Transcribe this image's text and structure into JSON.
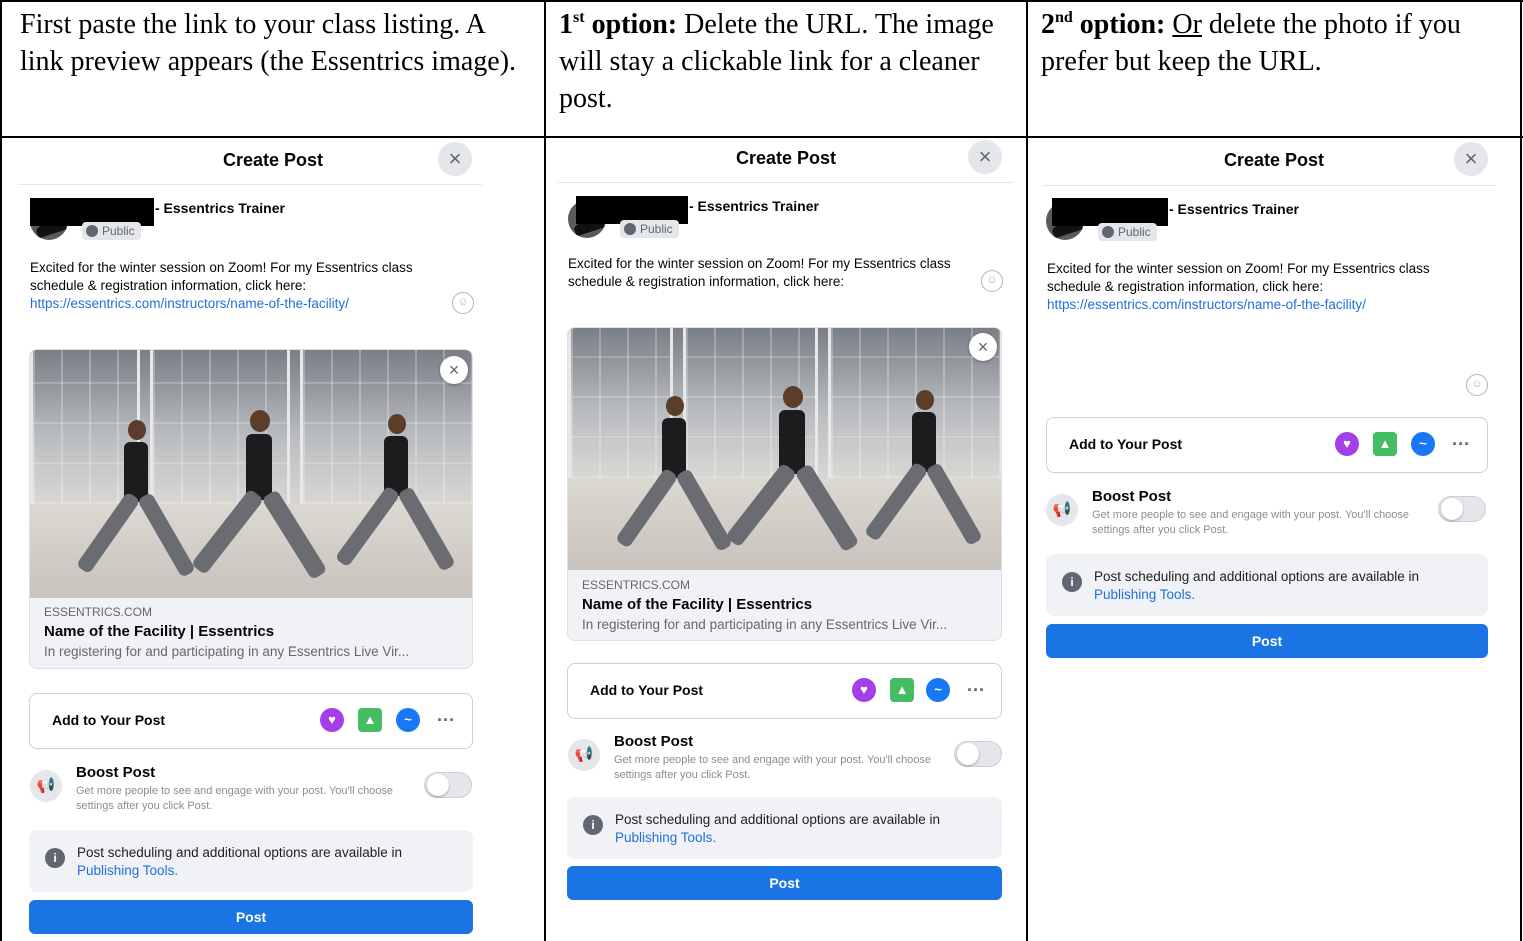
{
  "captions": {
    "col1": "First paste the link to your class listing. A link preview appears (the Essentrics image).",
    "col2_bold": "1",
    "col2_sup": "st",
    "col2_bold2": "option:",
    "col2_text": "Delete the URL. The image will stay a clickable link for a cleaner post.",
    "col3_bold": "2",
    "col3_sup": "nd",
    "col3_bold2": "option:",
    "col3_underline": "Or",
    "col3_text": "delete the photo if you prefer but keep the URL."
  },
  "post": {
    "title": "Create Post",
    "close_icon": "×",
    "user_suffix": "- Essentrics Trainer",
    "audience": "Public",
    "text": "Excited for the winter session on Zoom! For my Essentrics class schedule & registration information, click here:",
    "url": "https://essentrics.com/instructors/name-of-the-facility/",
    "url_cursor": "https://essentrics.com/instructors/name-of-the-facility/",
    "smiley": "☺",
    "preview_domain": "ESSENTRICS.COM",
    "preview_title": "Name of the Facility | Essentrics",
    "preview_desc": "In registering for and participating in any Essentrics Live Vir...",
    "add_to_post": "Add to Your Post",
    "more": "···",
    "boost_title": "Boost Post",
    "boost_desc": "Get more people to see and engage with your post. You'll choose settings after you click Post.",
    "boost_on": false,
    "sched_text": "Post scheduling and additional options are available in",
    "sched_link": "Publishing Tools.",
    "post_button": "Post"
  },
  "colors": {
    "link": "#216fdb",
    "post_button": "#1b74e4",
    "panel_bg": "#f0f2f5"
  }
}
